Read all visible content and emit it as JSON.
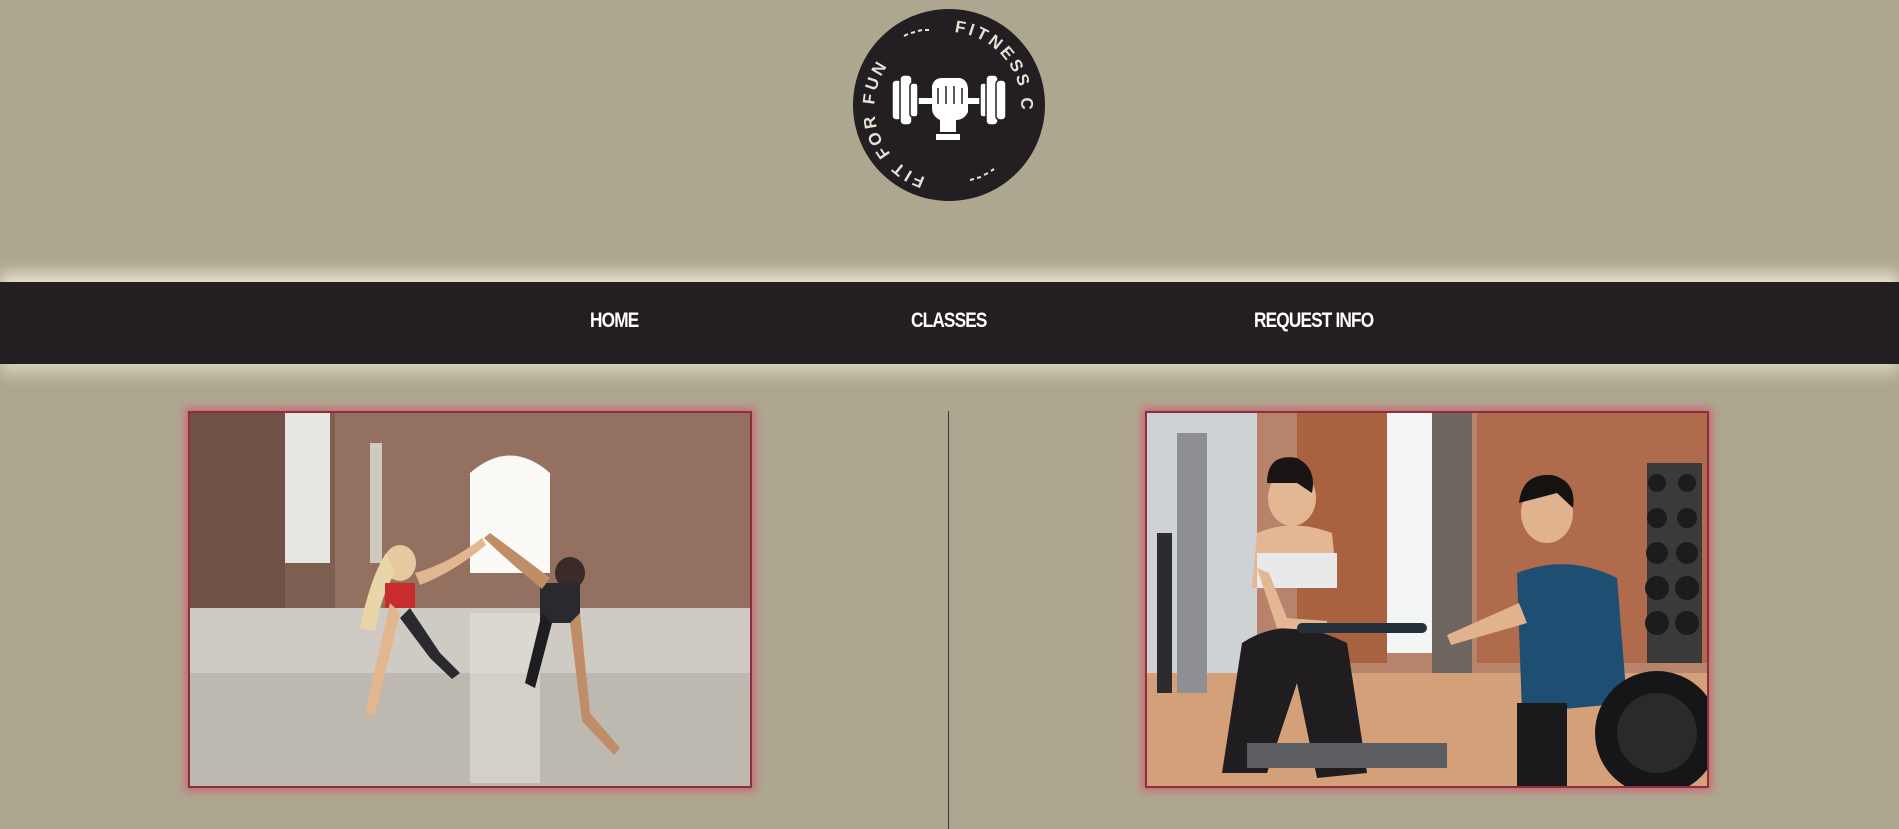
{
  "logo": {
    "arc_top": "FITNESS CLUB",
    "arc_left": "FIT FOR FUN",
    "icon": "fist-dumbbell-icon",
    "colors": {
      "circle": "#231e22",
      "text": "#e6e2d6"
    }
  },
  "nav": {
    "items": [
      {
        "label": "HOME"
      },
      {
        "label": "CLASSES"
      },
      {
        "label": "REQUEST INFO"
      }
    ]
  },
  "photos": [
    {
      "icon": "photo-two-women-plank-high-five"
    },
    {
      "icon": "photo-trainer-assisting-rowing-machine"
    }
  ],
  "colors": {
    "background": "#aea78f",
    "nav_bar": "#231e22",
    "photo_glow": "#d65270"
  }
}
